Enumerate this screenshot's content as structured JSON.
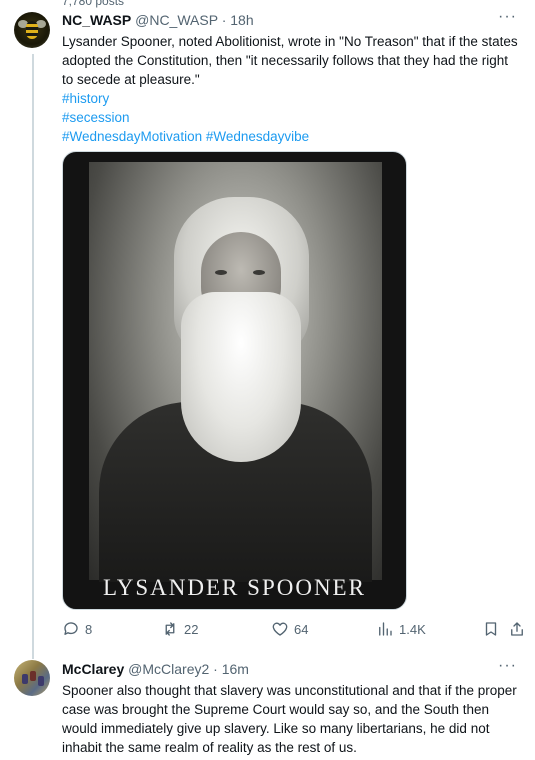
{
  "context": {
    "posts_count": "7,780 posts"
  },
  "tweets": [
    {
      "display_name": "NC_WASP",
      "handle": "@NC_WASP",
      "time": "18h",
      "text": "Lysander Spooner, noted Abolitionist, wrote in \"No Treason\" that if the states adopted the Constitution, then \"it necessarily follows that they had the right to secede at pleasure.\"",
      "hashtags": [
        "#history",
        "#secession",
        "#WednesdayMotivation",
        "#Wednesdayvibe"
      ],
      "media_caption": "LYSANDER SPOONER",
      "stats": {
        "replies": "8",
        "reposts": "22",
        "likes": "64",
        "views": "1.4K"
      }
    },
    {
      "display_name": "McClarey",
      "handle": "@McClarey2",
      "time": "16m",
      "text": "Spooner also thought that slavery was unconstitutional and that if the proper case was brought the Supreme Court would say so, and the South then would immediately give up slavery.  Like so many libertarians, he did not inhabit the same realm of reality as the rest of us."
    }
  ],
  "icons": {
    "more": "more-dots-icon",
    "reply": "reply-icon",
    "repost": "repost-icon",
    "like": "heart-icon",
    "views": "views-chart-icon",
    "bookmark": "bookmark-icon",
    "share": "share-icon"
  },
  "colors": {
    "link": "#1d9bf0",
    "muted": "#536471",
    "text": "#0f1419",
    "divider": "#cfd9de"
  }
}
